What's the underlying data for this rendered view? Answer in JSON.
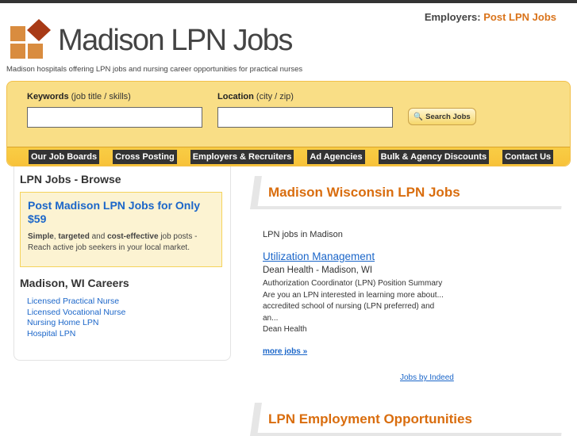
{
  "header": {
    "employers_label": "Employers:",
    "post_link": "Post LPN Jobs",
    "site_title": "Madison LPN Jobs",
    "tagline": "Madison hospitals offering LPN jobs and nursing career opportunities for practical nurses"
  },
  "search": {
    "keywords_label": "Keywords",
    "keywords_hint": "(job title / skills)",
    "keywords_value": "",
    "location_label": "Location",
    "location_hint": "(city / zip)",
    "location_value": "",
    "button": "Search Jobs"
  },
  "nav": [
    "Our Job Boards",
    "Cross Posting",
    "Employers & Recruiters",
    "Ad Agencies",
    "Bulk & Agency Discounts",
    "Contact Us"
  ],
  "sidebar": {
    "heading": "LPN Jobs - Browse",
    "promo_title": "Post Madison LPN Jobs for Only $59",
    "promo_b1": "Simple",
    "promo_b2": "targeted",
    "promo_t1": "and",
    "promo_b3": "cost-effective",
    "promo_t2": "job posts - Reach active job seekers in your local market.",
    "careers_heading": "Madison, WI Careers",
    "careers": [
      "Licensed Practical Nurse",
      "Licensed Vocational Nurse",
      "Nursing Home LPN",
      "Hospital LPN"
    ]
  },
  "main": {
    "section1": "Madison Wisconsin LPN Jobs",
    "intro": "LPN jobs in Madison",
    "job_title": "Utilization Management",
    "job_company": "Dean Health - Madison, WI",
    "job_desc": [
      "Authorization Coordinator (LPN) Position Summary",
      "Are you an LPN interested in learning more about...",
      "accredited school of nursing (LPN preferred) and",
      "an..."
    ],
    "job_source": "Dean Health",
    "more_jobs": "more jobs »",
    "jobs_by": "Jobs by Indeed",
    "section2": "LPN Employment Opportunities"
  }
}
